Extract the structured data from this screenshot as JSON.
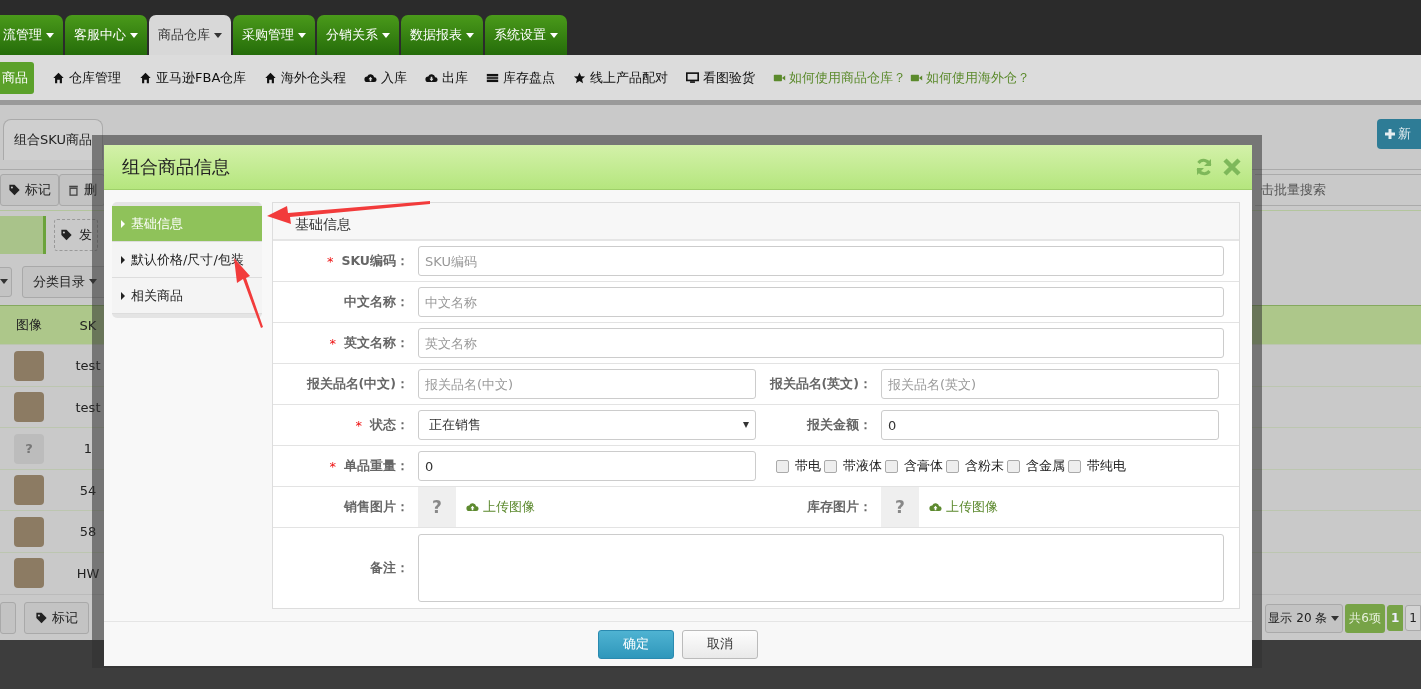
{
  "top_nav": {
    "tabs": [
      {
        "label": "流管理",
        "selected": false
      },
      {
        "label": "客服中心",
        "selected": false
      },
      {
        "label": "商品仓库",
        "selected": true
      },
      {
        "label": "采购管理",
        "selected": false
      },
      {
        "label": "分销关系",
        "selected": false
      },
      {
        "label": "数据报表",
        "selected": false
      },
      {
        "label": "系统设置",
        "selected": false
      }
    ]
  },
  "sub_nav": {
    "items": [
      {
        "label": "商品",
        "kind": "active"
      },
      {
        "label": "仓库管理",
        "kind": "home"
      },
      {
        "label": "亚马逊FBA仓库",
        "kind": "home"
      },
      {
        "label": "海外仓头程",
        "kind": "home"
      },
      {
        "label": "入库",
        "kind": "upload"
      },
      {
        "label": "出库",
        "kind": "download"
      },
      {
        "label": "库存盘点",
        "kind": "drive"
      },
      {
        "label": "线上产品配对",
        "kind": "star"
      },
      {
        "label": "看图验货",
        "kind": "monitor"
      },
      {
        "label": "如何使用商品仓库？",
        "kind": "video"
      },
      {
        "label": "如何使用海外仓？",
        "kind": "video"
      }
    ]
  },
  "page": {
    "tab": "组合SKU商品",
    "new_button": "新",
    "toolbar": [
      {
        "label": "标记",
        "kind": "tag"
      },
      {
        "label": "删",
        "kind": "trash"
      }
    ],
    "search_placeholder": "击批量搜索",
    "tag_button": "发",
    "category_button": "分类目录",
    "table": {
      "columns": [
        "图像",
        "SK"
      ],
      "rows": [
        {
          "kind": "photo",
          "sku": "test"
        },
        {
          "kind": "photo",
          "sku": "test"
        },
        {
          "kind": "placeholder",
          "image_mark": "?",
          "sku": "1"
        },
        {
          "kind": "photo",
          "sku": "54"
        },
        {
          "kind": "photo",
          "sku": "58"
        },
        {
          "kind": "photo",
          "sku": "HW"
        }
      ]
    },
    "bottom": {
      "mark_button": "标记",
      "page_size": "显示 20 条",
      "total": "共6项",
      "pages": [
        {
          "label": "1",
          "selected": true
        },
        {
          "label": "1",
          "selected": false
        }
      ]
    }
  },
  "dialog": {
    "title": "组合商品信息",
    "menu": [
      {
        "label": "基础信息",
        "selected": true
      },
      {
        "label": "默认价格/尺寸/包装",
        "selected": false
      },
      {
        "label": "相关商品",
        "selected": false
      }
    ],
    "section_title": "基础信息",
    "required_mark": "*",
    "fields": [
      {
        "kind": "text",
        "label": "SKU编码：",
        "required": true,
        "placeholder": "SKU编码"
      },
      {
        "kind": "text",
        "label": "中文名称：",
        "required": false,
        "placeholder": "中文名称"
      },
      {
        "kind": "text",
        "label": "英文名称：",
        "required": true,
        "placeholder": "英文名称"
      },
      {
        "kind": "pair",
        "label": "报关品名(中文)：",
        "required": false,
        "placeholder": "报关品名(中文)",
        "right": {
          "label": "报关品名(英文)：",
          "placeholder": "报关品名(英文)"
        }
      },
      {
        "kind": "select",
        "label": "状态：",
        "required": true,
        "value": "正在销售",
        "right": {
          "label": "报关金额：",
          "value": "0"
        }
      },
      {
        "kind": "weight",
        "label": "单品重量：",
        "required": true,
        "value": "0",
        "checkboxes": [
          {
            "label": "带电",
            "checked": false
          },
          {
            "label": "带液体",
            "checked": false
          },
          {
            "label": "含膏体",
            "checked": false
          },
          {
            "label": "含粉末",
            "checked": false
          },
          {
            "label": "含金属",
            "checked": false
          },
          {
            "label": "带纯电",
            "checked": false
          }
        ]
      },
      {
        "kind": "images",
        "label": "销售图片：",
        "required": false,
        "image_mark": "?",
        "upload": "上传图像",
        "right": {
          "label": "库存图片：",
          "image_mark": "?",
          "upload": "上传图像"
        }
      },
      {
        "kind": "textarea",
        "label": "备注：",
        "required": false
      }
    ],
    "buttons": [
      {
        "label": "确定",
        "kind": "primary"
      },
      {
        "label": "取消",
        "kind": "default"
      }
    ]
  }
}
